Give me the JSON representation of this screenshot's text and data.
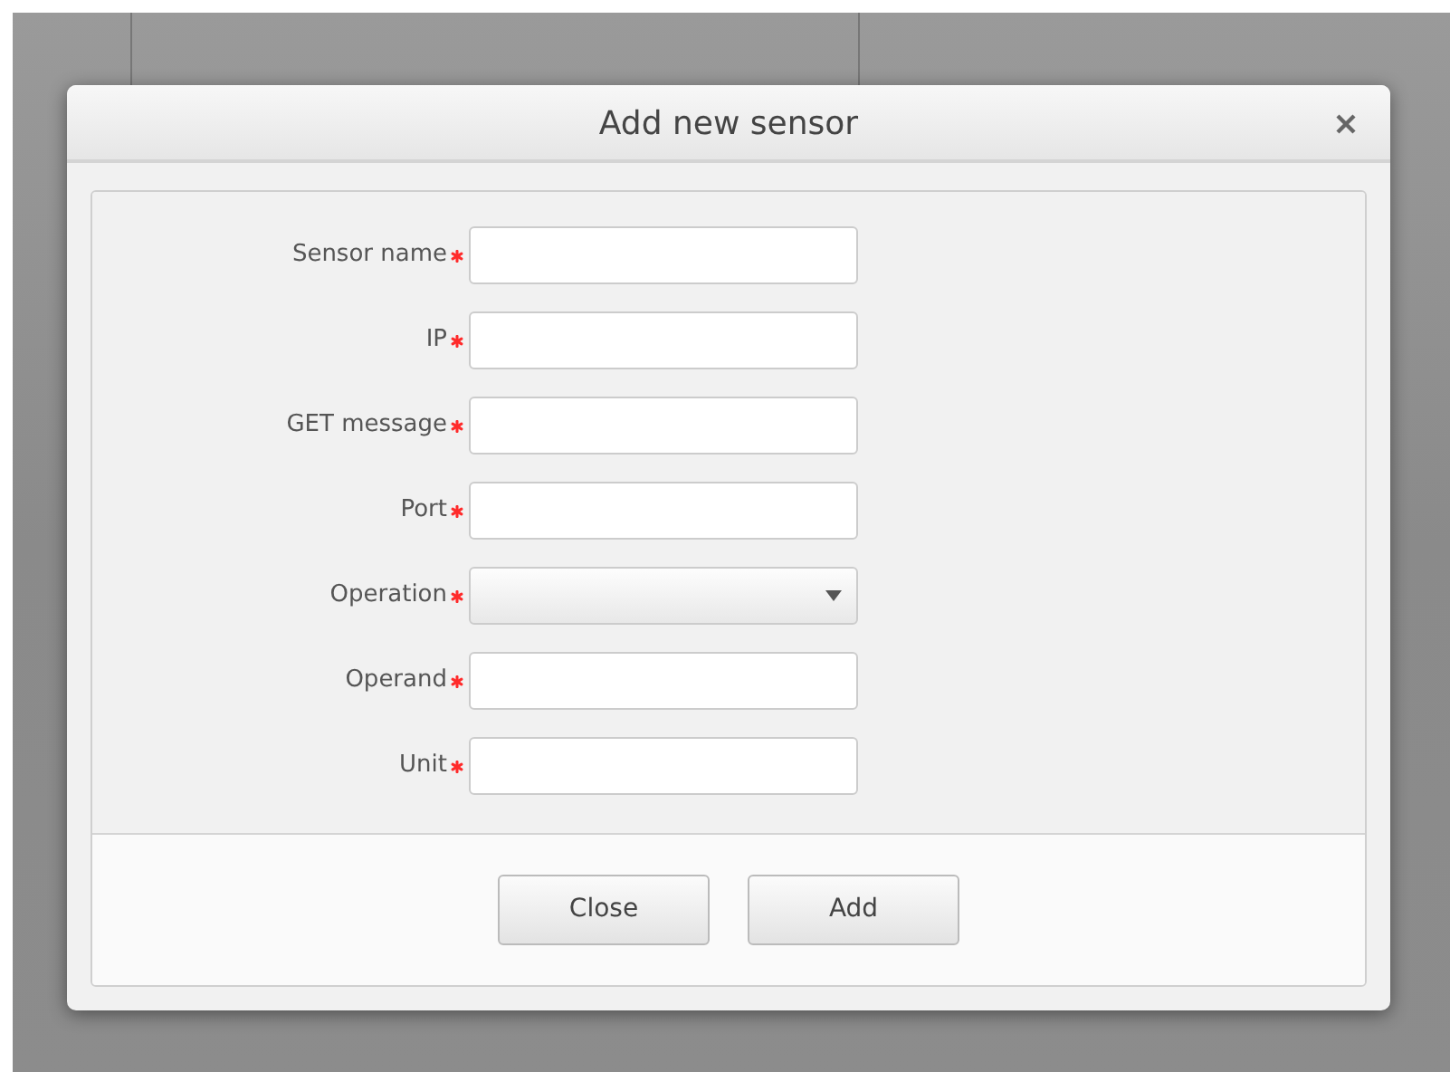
{
  "dialog": {
    "title": "Add new sensor",
    "fields": [
      {
        "label": "Sensor name",
        "kind": "text",
        "required": true
      },
      {
        "label": "IP",
        "kind": "text",
        "required": true
      },
      {
        "label": "GET message",
        "kind": "text",
        "required": true
      },
      {
        "label": "Port",
        "kind": "text",
        "required": true
      },
      {
        "label": "Operation",
        "kind": "select",
        "required": true
      },
      {
        "label": "Operand",
        "kind": "text",
        "required": true
      },
      {
        "label": "Unit",
        "kind": "text",
        "required": true
      }
    ],
    "buttons": [
      "Close",
      "Add"
    ]
  }
}
